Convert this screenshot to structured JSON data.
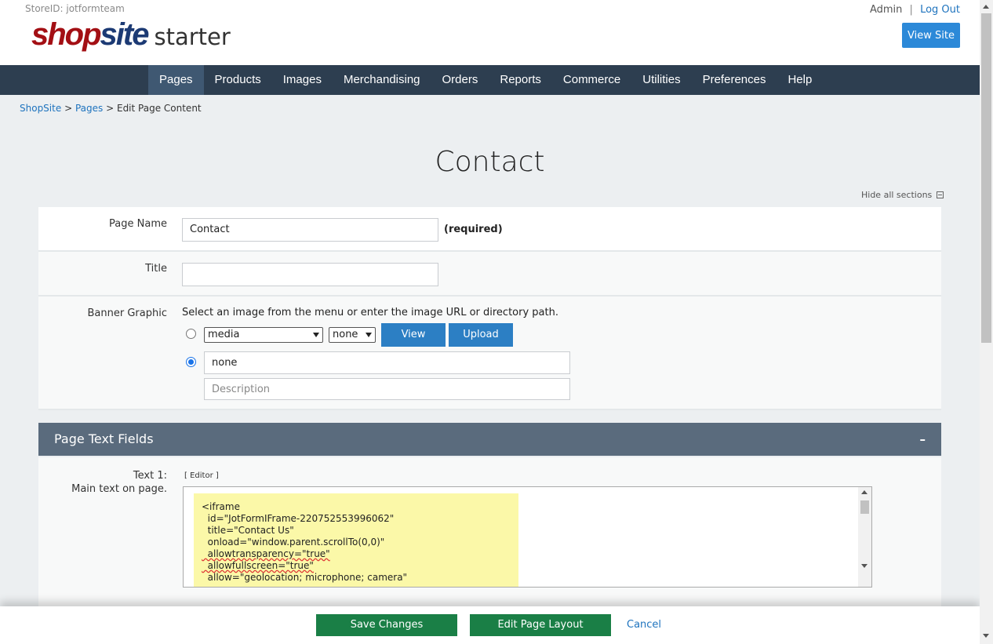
{
  "header": {
    "store_id": "StoreID: jotformteam",
    "logo_shop": "shop",
    "logo_site": "site",
    "logo_starter": "starter",
    "admin": "Admin",
    "separator": "|",
    "logout": "Log Out",
    "view_site": "View Site"
  },
  "nav": {
    "items": [
      "Pages",
      "Products",
      "Images",
      "Merchandising",
      "Orders",
      "Reports",
      "Commerce",
      "Utilities",
      "Preferences",
      "Help"
    ],
    "active": "Pages"
  },
  "breadcrumb": {
    "root": "ShopSite",
    "sep1": ">",
    "pages": "Pages",
    "sep2": ">",
    "current": "Edit Page Content"
  },
  "page": {
    "title": "Contact",
    "hide_sections": "Hide all sections"
  },
  "form": {
    "page_name_label": "Page Name",
    "page_name_value": "Contact",
    "page_name_required": "(required)",
    "title_label": "Title",
    "title_value": "",
    "banner_label": "Banner Graphic",
    "banner_instructions": "Select an image from the menu or enter the image URL or directory path.",
    "banner_dir_select": "media",
    "banner_file_select": "none",
    "view_button": "View",
    "upload_button": "Upload",
    "banner_url_value": "none",
    "description_placeholder": "Description"
  },
  "section": {
    "title": "Page Text Fields",
    "collapse_symbol": "–",
    "text1_label": "Text 1:",
    "text1_sublabel": "Main text on page.",
    "editor_link": "[ Editor ]",
    "code_lines": [
      "<iframe",
      "  id=\"JotFormIFrame-220752553996062\"",
      "  title=\"Contact Us\"",
      "  onload=\"window.parent.scrollTo(0,0)\"",
      "  allowtransparency=\"true\"",
      "  allowfullscreen=\"true\"",
      "  allow=\"geolocation; microphone; camera\""
    ]
  },
  "footer": {
    "save": "Save Changes",
    "edit_layout": "Edit Page Layout",
    "cancel": "Cancel"
  },
  "colors": {
    "nav_bg": "#2d3e50",
    "accent_blue": "#2c7fc4",
    "save_green": "#1a7f46",
    "logo_red": "#a30f14",
    "logo_blue": "#1c3a74"
  }
}
